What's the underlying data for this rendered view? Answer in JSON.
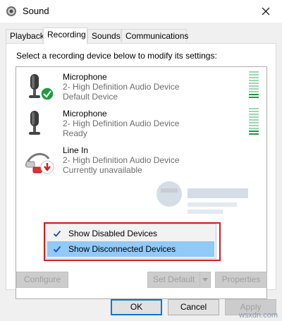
{
  "window": {
    "title": "Sound"
  },
  "tabs": [
    {
      "label": "Playback",
      "active": false
    },
    {
      "label": "Recording",
      "active": true
    },
    {
      "label": "Sounds",
      "active": false
    },
    {
      "label": "Communications",
      "active": false
    }
  ],
  "instructions": "Select a recording device below to modify its settings:",
  "devices": [
    {
      "name": "Microphone",
      "description": "2- High Definition Audio Device",
      "status": "Default Device",
      "icon": "microphone-icon",
      "badge": "green-check-icon",
      "meter_level": 0.2
    },
    {
      "name": "Microphone",
      "description": "2- High Definition Audio Device",
      "status": "Ready",
      "icon": "microphone-icon",
      "badge": "",
      "meter_level": 0.2
    },
    {
      "name": "Line In",
      "description": "2- High Definition Audio Device",
      "status": "Currently unavailable",
      "icon": "line-in-cable-icon",
      "badge": "red-down-arrow-icon",
      "meter_level": 0
    }
  ],
  "context_menu": {
    "items": [
      {
        "label": "Show Disabled Devices",
        "checked": true,
        "hovered": false
      },
      {
        "label": "Show Disconnected Devices",
        "checked": true,
        "hovered": true
      }
    ]
  },
  "device_buttons": {
    "configure": "Configure",
    "set_default": "Set Default",
    "properties": "Properties"
  },
  "dialog_buttons": {
    "ok": "OK",
    "cancel": "Cancel",
    "apply": "Apply"
  },
  "watermark": {
    "site": "wsxdn.com"
  },
  "colors": {
    "accent": "#0078d7",
    "highlight": "#91c9f7",
    "meter_green": "#1e9b3f",
    "annotation_red": "#d01f1f"
  }
}
